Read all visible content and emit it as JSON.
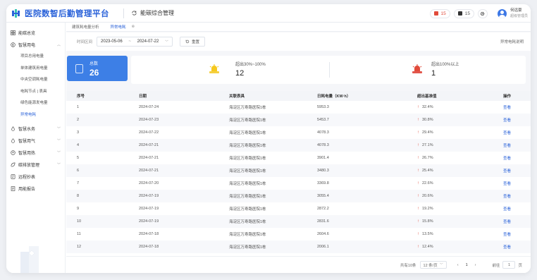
{
  "app": {
    "title": "医院数智后勤管理平台",
    "module": "能碳综合管理"
  },
  "topbar": {
    "alert_red": "15",
    "alert_dark": "15",
    "user_name": "何远豪",
    "user_role": "超级管理员"
  },
  "sidebar": {
    "items": [
      {
        "label": "能碳总览",
        "icon": "grid-icon"
      },
      {
        "label": "智慧用电",
        "icon": "lightning-icon",
        "expanded": true
      }
    ],
    "sub_items": [
      "项目总用电量",
      "单体建筑用电量",
      "中央空调耗电量",
      "电耗节点 | 表具",
      "绿色能源发电量",
      "异常电耗"
    ],
    "more_items": [
      {
        "label": "智慧水务",
        "icon": "water-icon"
      },
      {
        "label": "智慧用气",
        "icon": "gas-icon"
      },
      {
        "label": "智慧用热",
        "icon": "heat-icon"
      },
      {
        "label": "碳排放管理",
        "icon": "carbon-icon"
      },
      {
        "label": "远程抄表",
        "icon": "meter-icon"
      },
      {
        "label": "用能报告",
        "icon": "report-icon"
      }
    ]
  },
  "tabs": [
    {
      "label": "建筑耗电量分析"
    },
    {
      "label": "异常电耗"
    }
  ],
  "filter": {
    "label": "时间区间",
    "start": "2023-05-06",
    "end": "2024-07-22",
    "reset": "重置",
    "explain": "异常电耗说明"
  },
  "cards": {
    "total_label": "总数",
    "total_value": "26",
    "mid_label": "超出30%~100%",
    "mid_value": "12",
    "high_label": "超出100%以上",
    "high_value": "1"
  },
  "table": {
    "headers": [
      "序号",
      "日期",
      "关联表具",
      "日耗电量（KW·h）",
      "超出基准值",
      "操作"
    ],
    "rows": [
      [
        "1",
        "2024-07-24",
        "海淀区万寿路医院1栋",
        "5953.3",
        "32.4%",
        "查看"
      ],
      [
        "2",
        "2024-07-23",
        "海淀区万寿路医院1栋",
        "5453.7",
        "30.8%",
        "查看"
      ],
      [
        "3",
        "2024-07-22",
        "海淀区万寿路医院1栋",
        "4078.3",
        "29.4%",
        "查看"
      ],
      [
        "4",
        "2024-07-21",
        "海淀区万寿路医院1栋",
        "4078.3",
        "27.1%",
        "查看"
      ],
      [
        "5",
        "2024-07-21",
        "海淀区万寿路医院1栋",
        "3901.4",
        "26.7%",
        "查看"
      ],
      [
        "6",
        "2024-07-21",
        "海淀区万寿路医院1栋",
        "3480.3",
        "25.4%",
        "查看"
      ],
      [
        "7",
        "2024-07-20",
        "海淀区万寿路医院1栋",
        "3369.8",
        "22.6%",
        "查看"
      ],
      [
        "8",
        "2024-07-19",
        "海淀区万寿路医院1栋",
        "3055.4",
        "20.6%",
        "查看"
      ],
      [
        "9",
        "2024-07-19",
        "海淀区万寿路医院1栋",
        "2872.2",
        "19.2%",
        "查看"
      ],
      [
        "10",
        "2024-07-19",
        "海淀区万寿路医院1栋",
        "2831.6",
        "15.8%",
        "查看"
      ],
      [
        "11",
        "2024-07-18",
        "海淀区万寿路医院1栋",
        "2604.6",
        "13.5%",
        "查看"
      ],
      [
        "12",
        "2024-07-18",
        "海淀区万寿路医院1栋",
        "2006.1",
        "12.4%",
        "查看"
      ]
    ]
  },
  "pager": {
    "total": "共有10条",
    "page_size": "12 条/页",
    "current": "1",
    "goto_label": "前往",
    "goto_value": "1",
    "goto_suffix": "页"
  },
  "colors": {
    "primary": "#2a62d9",
    "card_blue": "#3d7fe6",
    "warn_red": "#e14b3b"
  }
}
